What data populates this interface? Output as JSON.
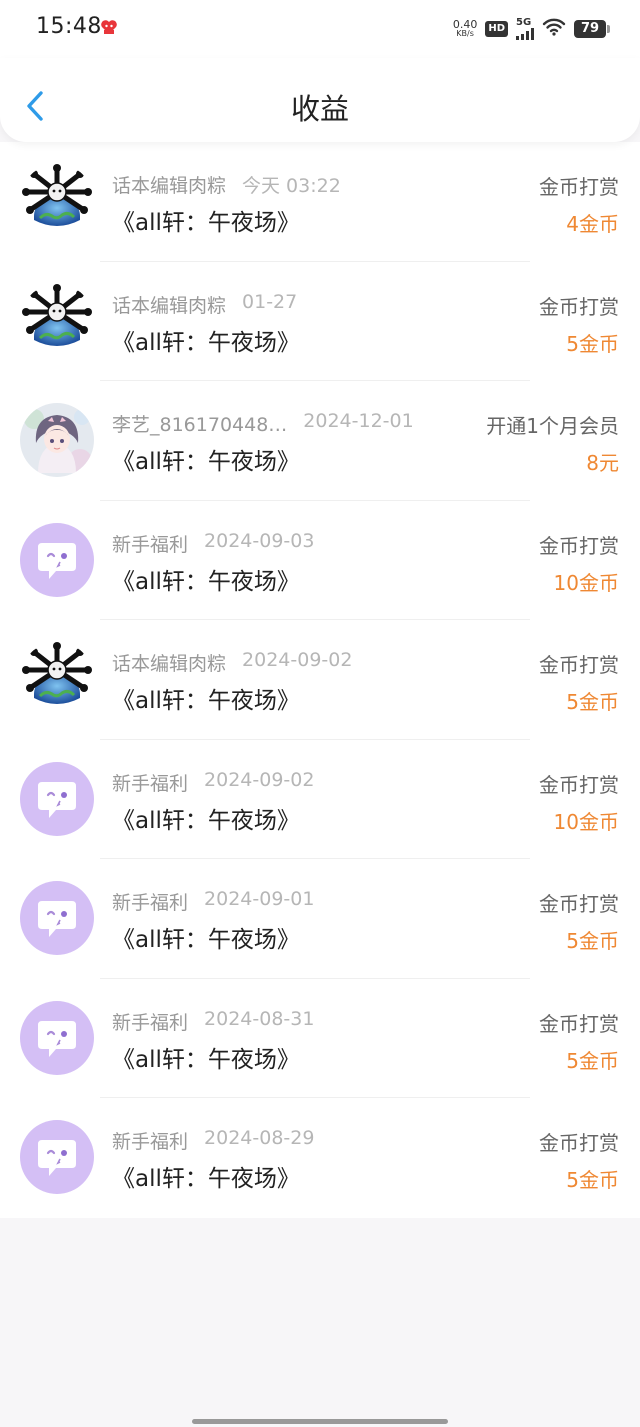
{
  "status_bar": {
    "time": "15:48",
    "net_speed_value": "0.40",
    "net_speed_unit": "KB/s",
    "hd_label": "HD",
    "network": "5G",
    "battery": "79"
  },
  "header": {
    "title": "收益"
  },
  "records": [
    {
      "user": "话本编辑肉粽",
      "date": "今天 03:22",
      "work": "《all轩：午夜场》",
      "type": "金币打赏",
      "amount": "4金币",
      "avatar": "editor"
    },
    {
      "user": "话本编辑肉粽",
      "date": "01-27",
      "work": "《all轩：午夜场》",
      "type": "金币打赏",
      "amount": "5金币",
      "avatar": "editor"
    },
    {
      "user": "李艺_816170448…",
      "date": "2024-12-01",
      "work": "《all轩：午夜场》",
      "type": "开通1个月会员",
      "amount": "8元",
      "avatar": "anime-girl"
    },
    {
      "user": "新手福利",
      "date": "2024-09-03",
      "work": "《all轩：午夜场》",
      "type": "金币打赏",
      "amount": "10金币",
      "avatar": "chat-bubble"
    },
    {
      "user": "话本编辑肉粽",
      "date": "2024-09-02",
      "work": "《all轩：午夜场》",
      "type": "金币打赏",
      "amount": "5金币",
      "avatar": "editor"
    },
    {
      "user": "新手福利",
      "date": "2024-09-02",
      "work": "《all轩：午夜场》",
      "type": "金币打赏",
      "amount": "10金币",
      "avatar": "chat-bubble"
    },
    {
      "user": "新手福利",
      "date": "2024-09-01",
      "work": "《all轩：午夜场》",
      "type": "金币打赏",
      "amount": "5金币",
      "avatar": "chat-bubble"
    },
    {
      "user": "新手福利",
      "date": "2024-08-31",
      "work": "《all轩：午夜场》",
      "type": "金币打赏",
      "amount": "5金币",
      "avatar": "chat-bubble"
    },
    {
      "user": "新手福利",
      "date": "2024-08-29",
      "work": "《all轩：午夜场》",
      "type": "金币打赏",
      "amount": "5金币",
      "avatar": "chat-bubble"
    }
  ],
  "colors": {
    "accent_back": "#2e9be8",
    "amount": "#ef8833",
    "bubble_avatar_bg": "#d4bff5"
  }
}
